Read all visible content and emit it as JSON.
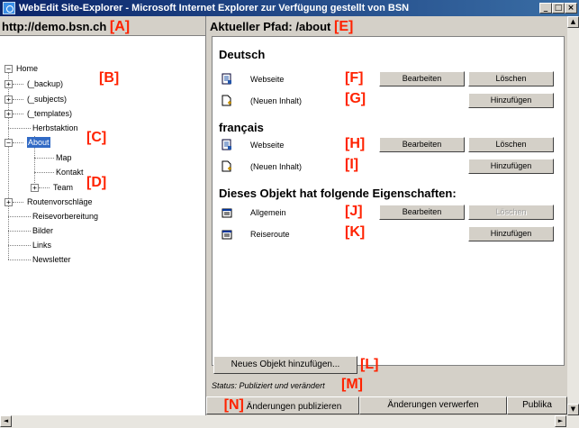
{
  "window": {
    "title": "WebEdit Site-Explorer - Microsoft Internet Explorer  zur Verfügung gestellt von BSN",
    "min_label": "_",
    "max_label": "□",
    "close_label": "×"
  },
  "left": {
    "header": "http://demo.bsn.ch",
    "marker": "[A]",
    "tree": {
      "root": "Home",
      "items": {
        "backup": "(_backup)",
        "subjects": "(_subjects)",
        "templates": "(_templates)",
        "herbstaktion": "Herbstaktion",
        "about": "About",
        "map": "Map",
        "kontakt": "Kontakt",
        "team": "Team",
        "routenvorschlaege": "Routenvorschläge",
        "reisevorbereitung": "Reisevorbereitung",
        "bilder": "Bilder",
        "links": "Links",
        "newsletter": "Newsletter"
      },
      "markers": {
        "b": "[B]",
        "c": "[C]",
        "d": "[D]"
      },
      "expand_symbol": "+",
      "collapse_symbol": "−"
    }
  },
  "right": {
    "header": "Aktueller Pfad: /about",
    "marker": "[E]",
    "deutsch": {
      "title": "Deutsch",
      "row1_label": "Webseite",
      "row1_marker": "[F]",
      "row1_btn1": "Bearbeiten",
      "row1_btn2": "Löschen",
      "row2_label": "(Neuen Inhalt)",
      "row2_marker": "[G]",
      "row2_btn": "Hinzufügen"
    },
    "francais": {
      "title": "français",
      "row1_label": "Webseite",
      "row1_marker": "[H]",
      "row1_btn1": "Bearbeiten",
      "row1_btn2": "Löschen",
      "row2_label": "(Neuen Inhalt)",
      "row2_marker": "[I]",
      "row2_btn": "Hinzufügen"
    },
    "properties": {
      "title": "Dieses Objekt hat folgende Eigenschaften:",
      "row1_label": "Allgemein",
      "row1_marker": "[J]",
      "row1_btn1": "Bearbeiten",
      "row1_btn2": "Löschen",
      "row2_label": "Reiseroute",
      "row2_marker": "[K]",
      "row2_btn": "Hinzufügen"
    },
    "add_object_btn": "Neues Objekt hinzufügen...",
    "add_object_marker": "[L]",
    "status": "Status: Publiziert und verändert",
    "status_marker": "[M]",
    "publish_marker": "[N]",
    "publish_btn": "Änderungen publizieren",
    "discard_btn": "Änderungen verwerfen",
    "publika_btn": "Publika"
  },
  "scroll": {
    "up": "▲",
    "down": "▼",
    "left": "◄",
    "right": "►"
  }
}
